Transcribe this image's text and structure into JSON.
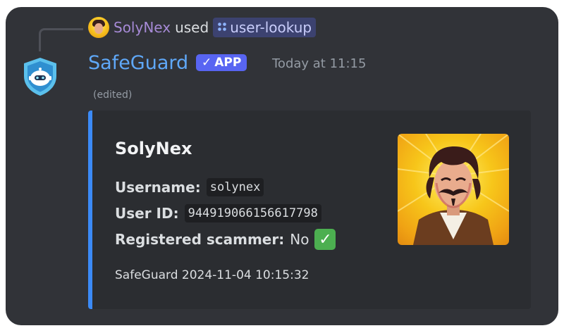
{
  "reply": {
    "user": "SolyNex",
    "used_text": "used",
    "command_icon": "slash-command-icon",
    "command": "user-lookup"
  },
  "message": {
    "author": "SafeGuard",
    "badge": "APP",
    "badge_icon": "check-icon",
    "timestamp": "Today at 11:15",
    "edited": "(edited)"
  },
  "embed": {
    "accent_color": "#3b8af7",
    "title": "SolyNex",
    "fields": [
      {
        "label": "Username:",
        "value": "solynex"
      },
      {
        "label": "User ID:",
        "value": "944919066156617798"
      },
      {
        "label": "Registered scammer:",
        "value": "No",
        "status_icon": "green-check-icon"
      }
    ],
    "footer": "SafeGuard 2024-11-04 10:15:32",
    "thumbnail": "user-avatar-image"
  },
  "colors": {
    "background": "#313338",
    "embed_bg": "#2b2d31",
    "author_name": "#5fa8f8",
    "app_badge": "#5865f2",
    "reply_user": "#a68ad6"
  }
}
